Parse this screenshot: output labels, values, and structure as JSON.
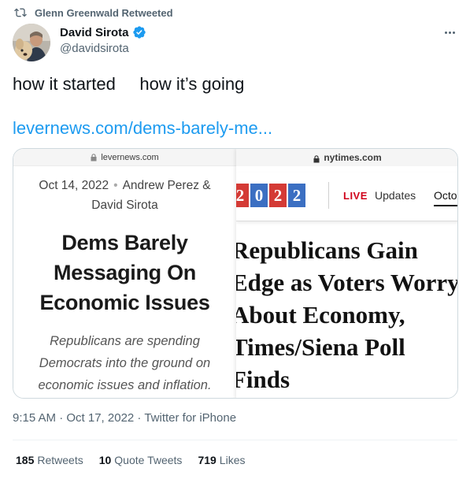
{
  "retweet_context": {
    "text": "Glenn Greenwald Retweeted"
  },
  "author": {
    "name": "David Sirota",
    "handle": "@davidsirota"
  },
  "tweet": {
    "text": "how it started     how it’s going",
    "link": "levernews.com/dems-barely-me..."
  },
  "media": {
    "left": {
      "domain": "levernews.com",
      "date": "Oct 14, 2022",
      "authors_line1": "Andrew Perez &",
      "authors_line2": "David Sirota",
      "headline": [
        "Dems Barely",
        "Messaging On",
        "Economic Issues"
      ],
      "subhead": [
        "Republicans are spending",
        "Democrats into the ground on",
        "economic issues and inflation."
      ]
    },
    "right": {
      "domain": "nytimes.com",
      "year_digits": [
        "2",
        "0",
        "2",
        "2"
      ],
      "live_label": "LIVE",
      "updates_label": "Updates",
      "date_tab": "Octo",
      "headline": [
        "Republicans Gain",
        "Edge as Voters Worry",
        "About Economy,",
        "Times/Siena Poll",
        "Finds"
      ]
    }
  },
  "meta": {
    "timestamp": "9:15 AM · Oct 17, 2022 · Twitter for iPhone"
  },
  "stats": {
    "retweets": {
      "count": "185",
      "label": "Retweets"
    },
    "quotes": {
      "count": "10",
      "label": "Quote Tweets"
    },
    "likes": {
      "count": "719",
      "label": "Likes"
    }
  },
  "colors": {
    "link": "#1d9bf0",
    "muted": "#536471",
    "nyt_red": "#d43a35",
    "nyt_blue": "#3b6fc2",
    "live_red": "#d0021b"
  },
  "icons": {
    "retweet": "retweet-icon",
    "verified": "verified-badge-icon",
    "more": "more-options-icon",
    "lock": "lock-icon"
  }
}
